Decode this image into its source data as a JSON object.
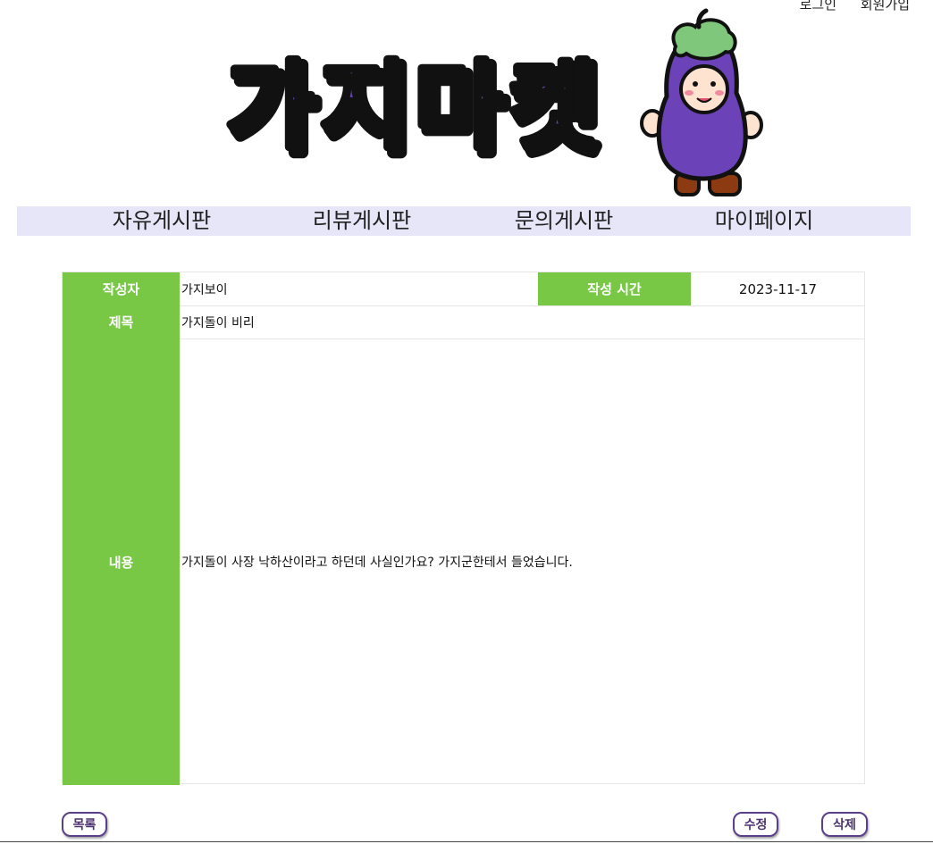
{
  "header": {
    "login_label": "로그인",
    "signup_label": "회원가입",
    "logo_text": "가지마켓",
    "colors": {
      "logo_purple": "#6b42b8",
      "logo_shadow": "#111111",
      "nav_bg": "#e6e6f8"
    }
  },
  "nav": {
    "items": [
      {
        "label": "자유게시판"
      },
      {
        "label": "리뷰게시판"
      },
      {
        "label": "문의게시판"
      },
      {
        "label": "마이페이지"
      }
    ]
  },
  "post": {
    "author_label": "작성자",
    "author": "가지보이",
    "time_label": "작성 시간",
    "time": "2023-11-17",
    "title_label": "제목",
    "title": "가지돌이 비리",
    "content_label": "내용",
    "content": "가지돌이 사장 낙하산이라고 하던데 사실인가요? 가지군한테서 들었습니다.",
    "colors": {
      "label_bg": "#78c846",
      "border": "#e6e6e6"
    }
  },
  "actions": {
    "list_label": "목록",
    "edit_label": "수정",
    "delete_label": "삭제",
    "color": "#5c3f8a"
  }
}
